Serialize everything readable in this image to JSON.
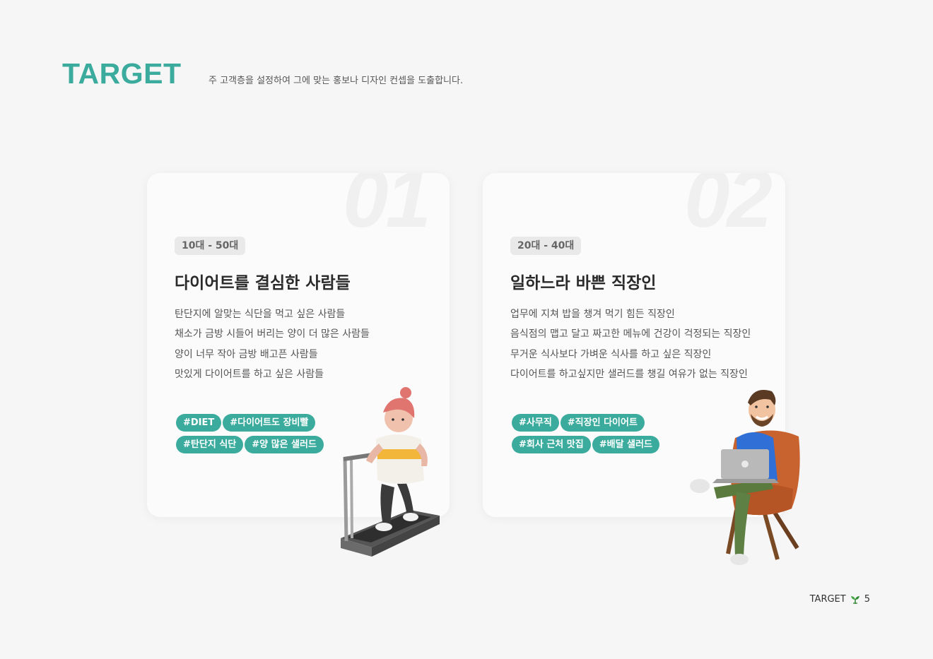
{
  "header": {
    "title": "TARGET",
    "subtitle": "주 고객층을 설정하여 그에 맞는 홍보나 디자인 컨셉을 도출합니다."
  },
  "cards": [
    {
      "number": "01",
      "age": "10대 - 50대",
      "heading": "다이어트를 결심한 사람들",
      "lines": [
        "탄단지에 알맞는 식단을 먹고 싶은 사람들",
        "채소가 금방 시들어 버리는 양이 더 많은 사람들",
        "양이 너무 작아 금방 배고픈 사람들",
        "맛있게 다이어트를 하고 싶은 사람들"
      ],
      "tags": [
        "#DIET",
        "#다이어트도 장비빨",
        "#탄단지 식단",
        "#양 많은 샐러드"
      ],
      "illustration": "woman-on-treadmill"
    },
    {
      "number": "02",
      "age": "20대 - 40대",
      "heading": "일하느라 바쁜 직장인",
      "lines": [
        "업무에 지쳐 밥을 챙겨 먹기 힘든 직장인",
        "음식점의 맵고 달고 짜고한 메뉴에 건강이 걱정되는 직장인",
        "무거운 식사보다 가벼운 식사를 하고 싶은 직장인",
        "다이어트를 하고싶지만 샐러드를 챙길 여유가 없는 직장인"
      ],
      "tags": [
        "#사무직",
        "#직장인 다이어트",
        "#회사 근처 맛집",
        "#배달 샐러드"
      ],
      "illustration": "man-with-laptop-in-chair"
    }
  ],
  "footer": {
    "label": "TARGET",
    "icon": "sprout-icon",
    "page": "5"
  },
  "colors": {
    "accent": "#3aab9c",
    "background": "#f6f6f6",
    "card": "#fbfbfb"
  }
}
